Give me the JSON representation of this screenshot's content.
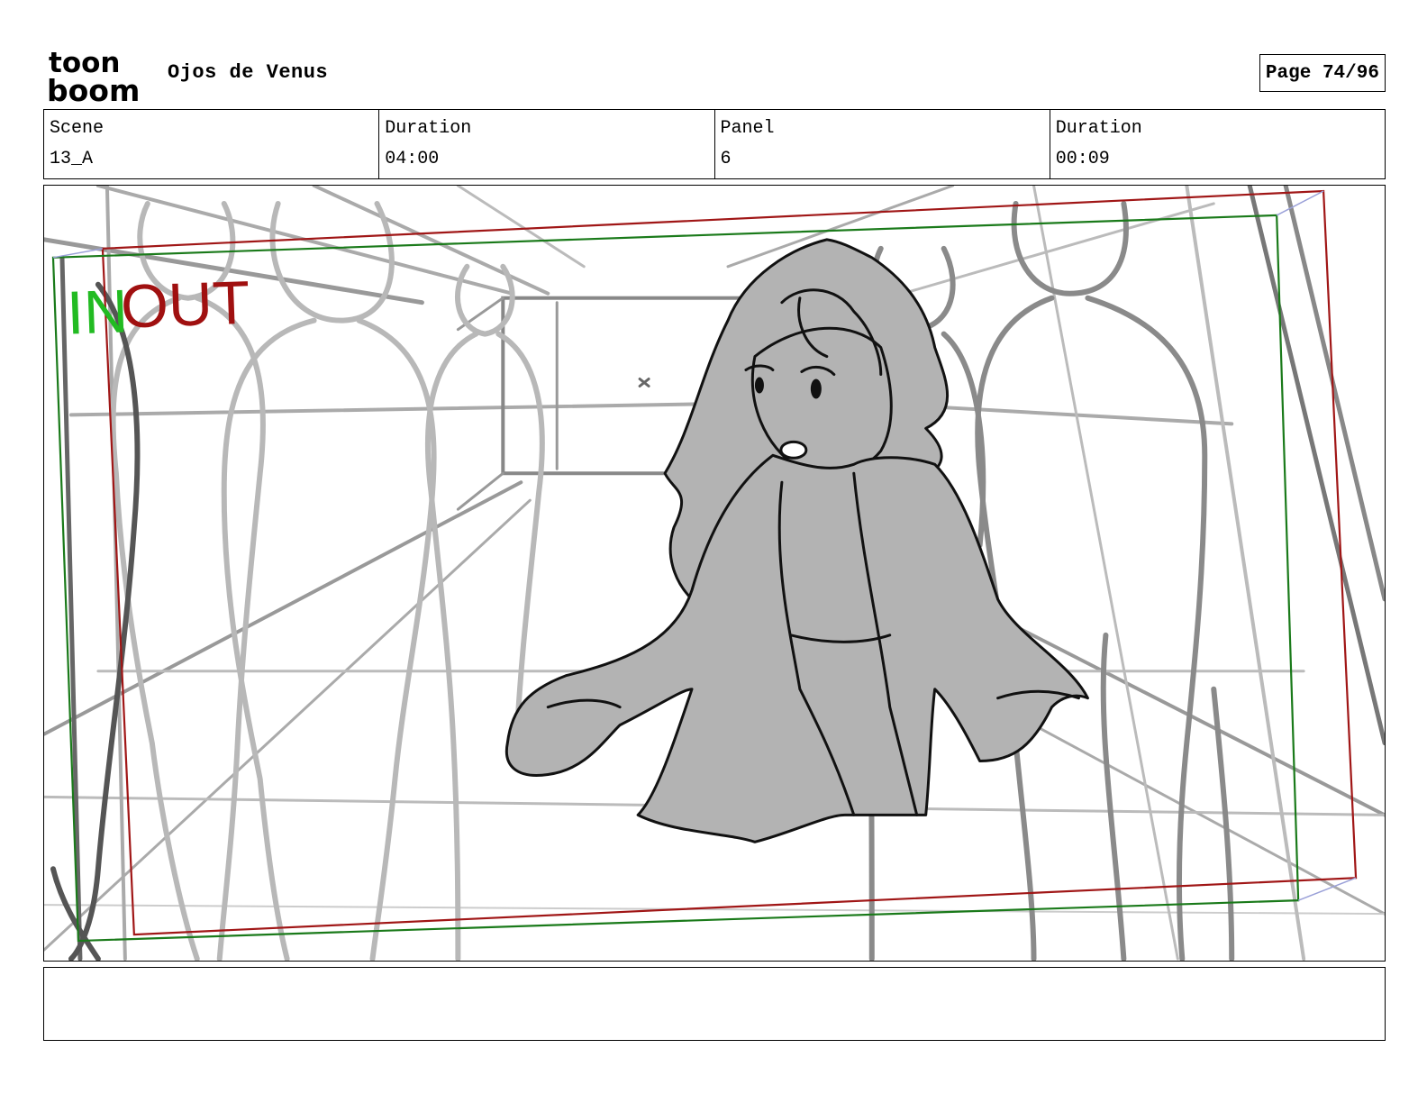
{
  "header": {
    "logo_top": "toon",
    "logo_bottom": "boom",
    "project_title": "Ojos de Venus",
    "page_label": "Page",
    "page_current": "74",
    "page_total": "96"
  },
  "info": {
    "scene_label": "Scene",
    "scene_value": "13_A",
    "scene_duration_label": "Duration",
    "scene_duration_value": "04:00",
    "panel_label": "Panel",
    "panel_value": "6",
    "panel_duration_label": "Duration",
    "panel_duration_value": "00:09"
  },
  "panel": {
    "in_label": "IN",
    "out_label": "OUT",
    "colors": {
      "in_frame": "#1a7a1a",
      "out_frame": "#a01616",
      "in_text": "#22bb22",
      "out_text": "#a01010",
      "sketch_light": "#b8b8b8",
      "sketch_mid": "#8a8a8a",
      "sketch_dark": "#555555",
      "character_fill": "#b3b3b3",
      "ink": "#111111"
    }
  },
  "notes": {
    "text": ""
  }
}
